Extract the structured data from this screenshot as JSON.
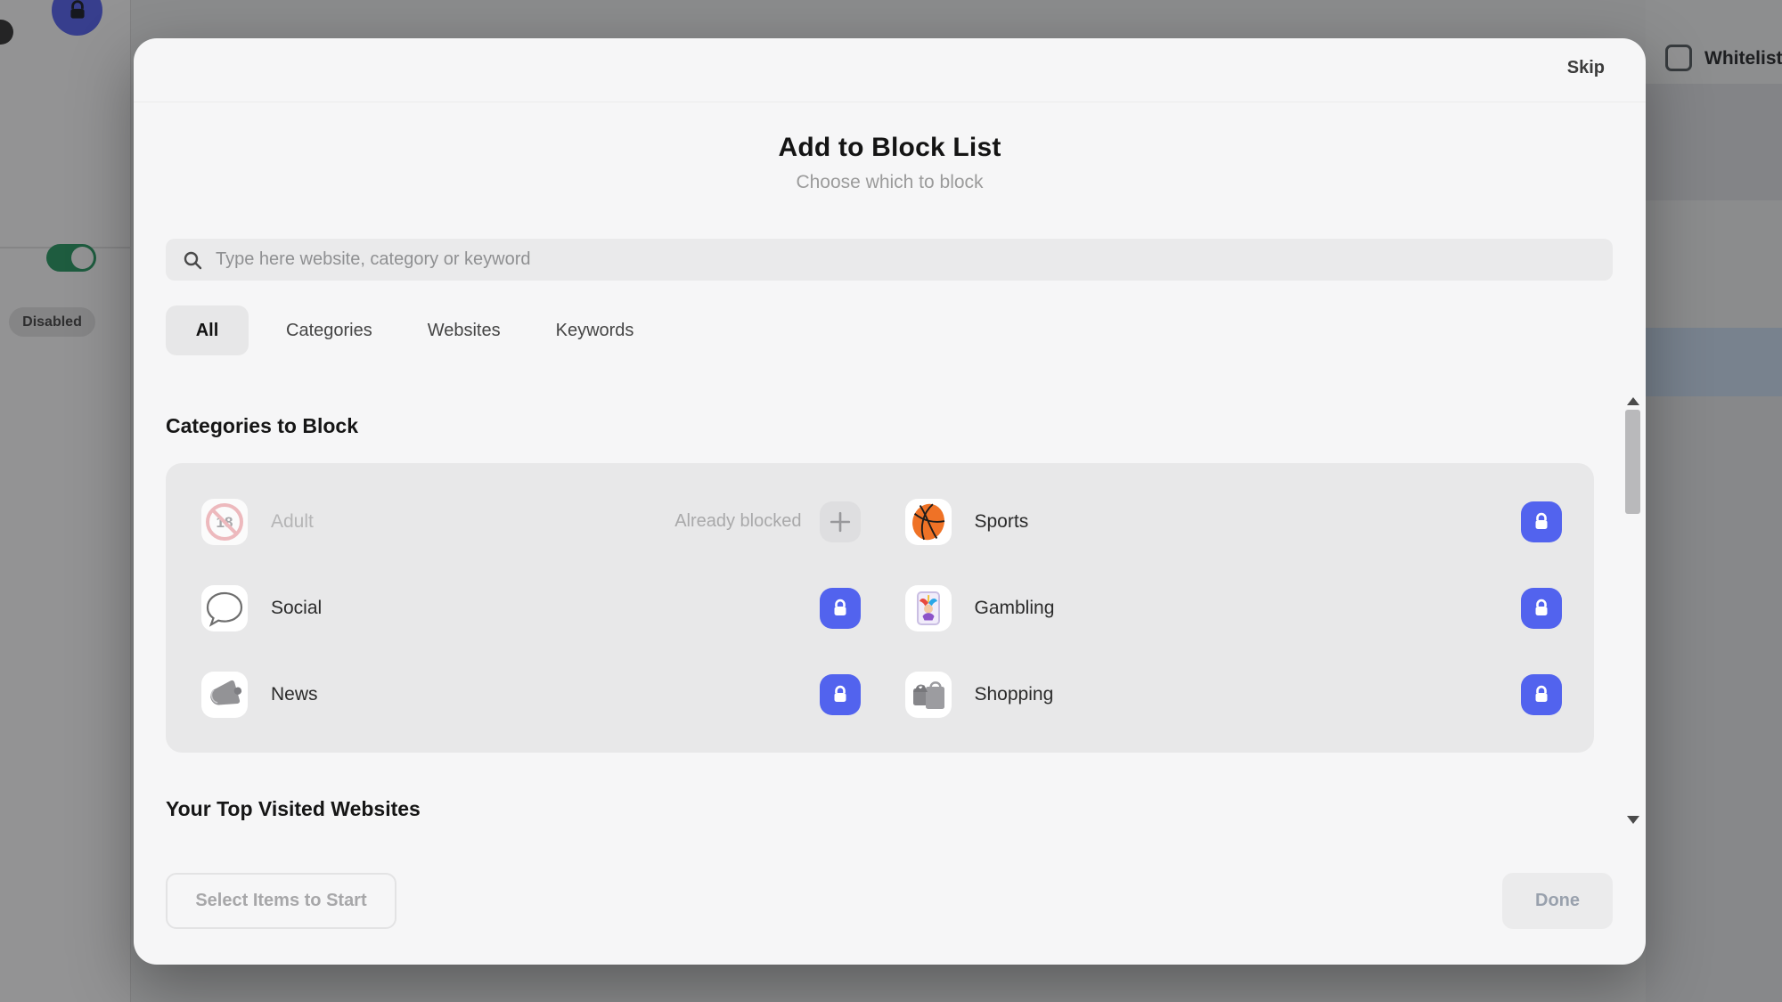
{
  "colors": {
    "accent_blue": "#5263ee",
    "toggle_green": "#2f9e68",
    "selected_row_blue": "#cfe0f4",
    "modal_bg": "#f6f6f7",
    "panel_bg": "#e8e8e9"
  },
  "background": {
    "whitelist_label": "Whitelist",
    "whitelist_checked": false,
    "lock_badge_icon": "lock-icon",
    "toggle_on": true,
    "disabled_badge": "Disabled"
  },
  "modal": {
    "skip_label": "Skip",
    "title": "Add to Block List",
    "subtitle": "Choose which to block",
    "search": {
      "icon": "search-icon",
      "placeholder": "Type here website, category or keyword",
      "value": ""
    },
    "tabs": [
      {
        "label": "All",
        "active": true
      },
      {
        "label": "Categories",
        "active": false
      },
      {
        "label": "Websites",
        "active": false
      },
      {
        "label": "Keywords",
        "active": false
      }
    ],
    "categories_section": {
      "heading": "Categories to Block"
    },
    "categories": [
      {
        "name": "Adult",
        "icon": "no-under-18-icon",
        "status": "Already blocked",
        "action_icon": "plus-icon",
        "disabled": true
      },
      {
        "name": "Sports",
        "icon": "basketball-icon",
        "action_icon": "lock-icon",
        "disabled": false
      },
      {
        "name": "Social",
        "icon": "speech-bubble-icon",
        "action_icon": "lock-icon",
        "disabled": false
      },
      {
        "name": "Gambling",
        "icon": "joker-card-icon",
        "action_icon": "lock-icon",
        "disabled": false
      },
      {
        "name": "News",
        "icon": "megaphone-icon",
        "action_icon": "lock-icon",
        "disabled": false
      },
      {
        "name": "Shopping",
        "icon": "shopping-bags-icon",
        "action_icon": "lock-icon",
        "disabled": false
      }
    ],
    "top_websites_section": {
      "heading": "Your Top Visited Websites"
    },
    "footer": {
      "select_label": "Select Items to Start",
      "done_label": "Done"
    }
  }
}
